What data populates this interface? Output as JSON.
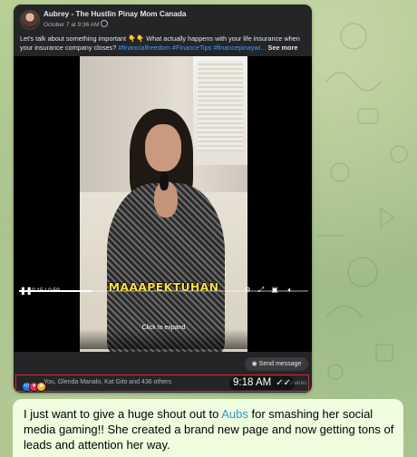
{
  "post": {
    "author": "Aubrey - The Hustlin Pinay Mom Canada",
    "date": "October 7 at 9:36 AM",
    "caption_text": "Let's talk about something important 👇👇 What actually happens with your life insurance when your insurance company closes? ",
    "caption_tags": "#financialfreedom #FinanceTips #financepinaywi...",
    "see_more": "See more"
  },
  "video": {
    "subtitle": "MAAAPEKTUHAN",
    "click_to_expand": "Click to expand",
    "time_display": "0:15 / 0:59",
    "progress": 0.25,
    "send_message_label": "Send message"
  },
  "reactions": {
    "icons": [
      "like-icon",
      "love-icon",
      "care-icon"
    ],
    "summary": "You, Glenda Manalo, Kat Gito and 436 others",
    "shares": "71 shares"
  },
  "message": {
    "timestamp": "9:18 AM",
    "ticks": "✓✓",
    "text_before": "I just want to give a huge shout out to ",
    "mention": "Aubs",
    "text_after": " for smashing her social media gaming!! She created a brand new page and now getting tons of leads and attention her way."
  },
  "colors": {
    "card_bg": "#242526",
    "link_blue": "#4599ff",
    "subtitle_yellow": "#ffe033",
    "highlight_red": "#e0242b",
    "bubble_bg": "#eefedf",
    "chat_bg": "#a9c28f"
  }
}
